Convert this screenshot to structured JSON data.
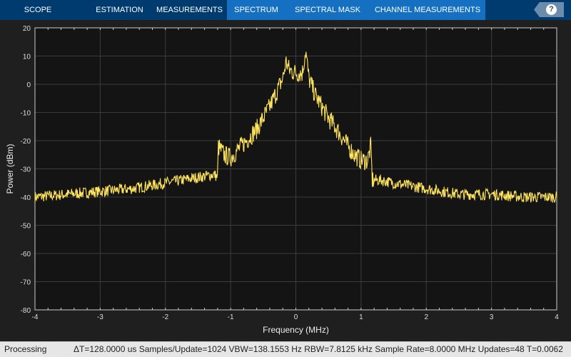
{
  "tabs": [
    {
      "label": "SCOPE",
      "selected": false
    },
    {
      "label": "ESTIMATION",
      "selected": false
    },
    {
      "label": "MEASUREMENTS",
      "selected": false
    },
    {
      "label": "SPECTRUM",
      "selected": true
    },
    {
      "label": "SPECTRAL MASK",
      "selected": true
    },
    {
      "label": "CHANNEL MEASUREMENTS",
      "selected": true
    }
  ],
  "help": {
    "icon": "help-icon",
    "label": "?"
  },
  "status": {
    "state": "Processing",
    "info": "ΔT=128.0000 us  Samples/Update=1024  VBW=138.1553 Hz  RBW=7.8125 kHz  Sample Rate=8.0000 MHz  Updates=48  T=0.0062"
  },
  "chart_data": {
    "type": "line",
    "xlabel": "Frequency (MHz)",
    "ylabel": "Power (dBm)",
    "xlim": [
      -4,
      4
    ],
    "ylim": [
      -80,
      20
    ],
    "xticks": [
      -4,
      -3,
      -2,
      -1,
      0,
      1,
      2,
      3,
      4
    ],
    "yticks": [
      20,
      10,
      0,
      -10,
      -20,
      -30,
      -40,
      -50,
      -60,
      -70,
      -80
    ],
    "grid": true,
    "colors": {
      "trace": "#ffe45c",
      "background": "#141414",
      "grid": "#3c3c3c"
    },
    "series": [
      {
        "x": [
          -4,
          -3.5,
          -3,
          -2.5,
          -2,
          -1.5,
          -1.25,
          -1.2,
          -1.19,
          -1.1,
          -1,
          -0.8,
          -0.6,
          -0.5,
          -0.4,
          -0.3,
          -0.2,
          -0.15,
          -0.1,
          0,
          0.1,
          0.15,
          0.2,
          0.3,
          0.4,
          0.5,
          0.6,
          0.8,
          0.9,
          1.0,
          1.1,
          1.15,
          1.17,
          1.3,
          1.5,
          2,
          2.5,
          3,
          3.5,
          4
        ],
        "y": [
          -40,
          -39,
          -38,
          -37,
          -35,
          -33,
          -32,
          -33,
          -22,
          -25,
          -26,
          -21,
          -16,
          -12,
          -8,
          -3,
          2,
          8,
          5,
          4,
          4,
          12,
          2,
          -4,
          -8,
          -12,
          -15,
          -22,
          -25,
          -27,
          -27,
          -22,
          -34,
          -34,
          -35,
          -37,
          -39,
          -39,
          -40,
          -40
        ]
      }
    ]
  }
}
